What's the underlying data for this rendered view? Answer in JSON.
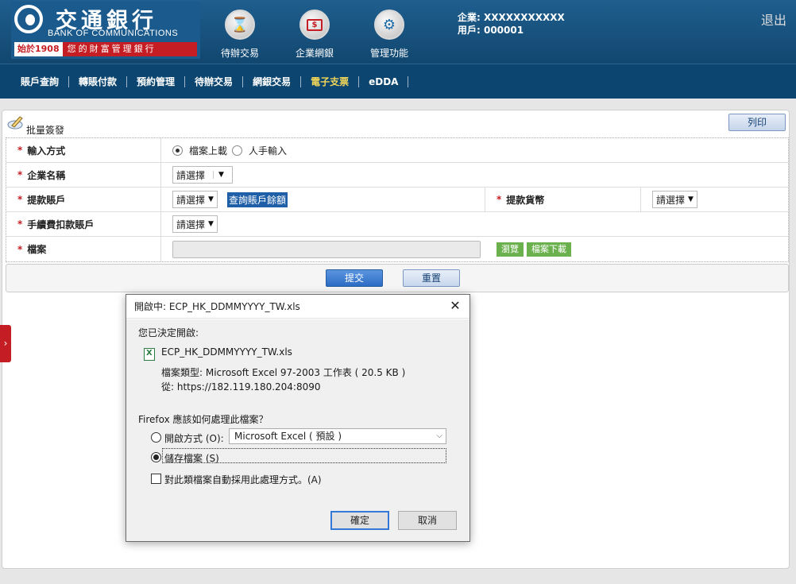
{
  "header": {
    "logo_cn": "交通銀行",
    "logo_en": "BANK OF COMMUNICATIONS",
    "logo_since": "始於1908",
    "logo_motto": "您的財富管理銀行",
    "nav": [
      {
        "label": "待辦交易",
        "icon": "hourglass-icon"
      },
      {
        "label": "企業網銀",
        "icon": "monitor-dollar-icon"
      },
      {
        "label": "管理功能",
        "icon": "gears-icon"
      }
    ],
    "company_line": "企業: XXXXXXXXXXX",
    "user_line": "用戶: 000001",
    "logout": "退出"
  },
  "menu": [
    "賬戶查詢",
    "轉賬付款",
    "預約管理",
    "待辦交易",
    "網銀交易",
    "電子支票",
    "eDDA"
  ],
  "menu_active": "電子支票",
  "panel": {
    "title": "批量簽發",
    "print": "列印"
  },
  "form": {
    "required_mark": "*",
    "input_method_label": "輸入方式",
    "input_method_options": [
      "檔案上載",
      "人手輸入"
    ],
    "company_label": "企業名稱",
    "company_select": "請選擇",
    "account_label": "提款賬戶",
    "account_select": "請選擇",
    "query_balance": "查詢賬戶餘額",
    "currency_label": "提款貨幣",
    "currency_select": "請選擇",
    "fee_label": "手續費扣款賬戶",
    "fee_select": "請選擇",
    "file_label": "檔案",
    "browse": "瀏覽",
    "download": "檔案下載",
    "submit": "提交",
    "reset": "重置"
  },
  "side_tab": "›",
  "dialog": {
    "title": "開啟中: ECP_HK_DDMMYYYY_TW.xls",
    "close": "✕",
    "decided": "您已決定開啟:",
    "filename": "ECP_HK_DDMMYYYY_TW.xls",
    "filetype": "檔案類型:  Microsoft Excel 97-2003 工作表 ( 20.5 KB )",
    "from": "從:  https://182.119.180.204:8090",
    "question": "Firefox 應該如何處理此檔案？",
    "open_with": "開啟方式 (O):",
    "open_with_u": "O",
    "app": "Microsoft Excel ( 預設 )",
    "save": "儲存檔案 (S)",
    "auto": "對此類檔案自動採用此處理方式。(A)",
    "ok": "確定",
    "cancel": "取消"
  }
}
